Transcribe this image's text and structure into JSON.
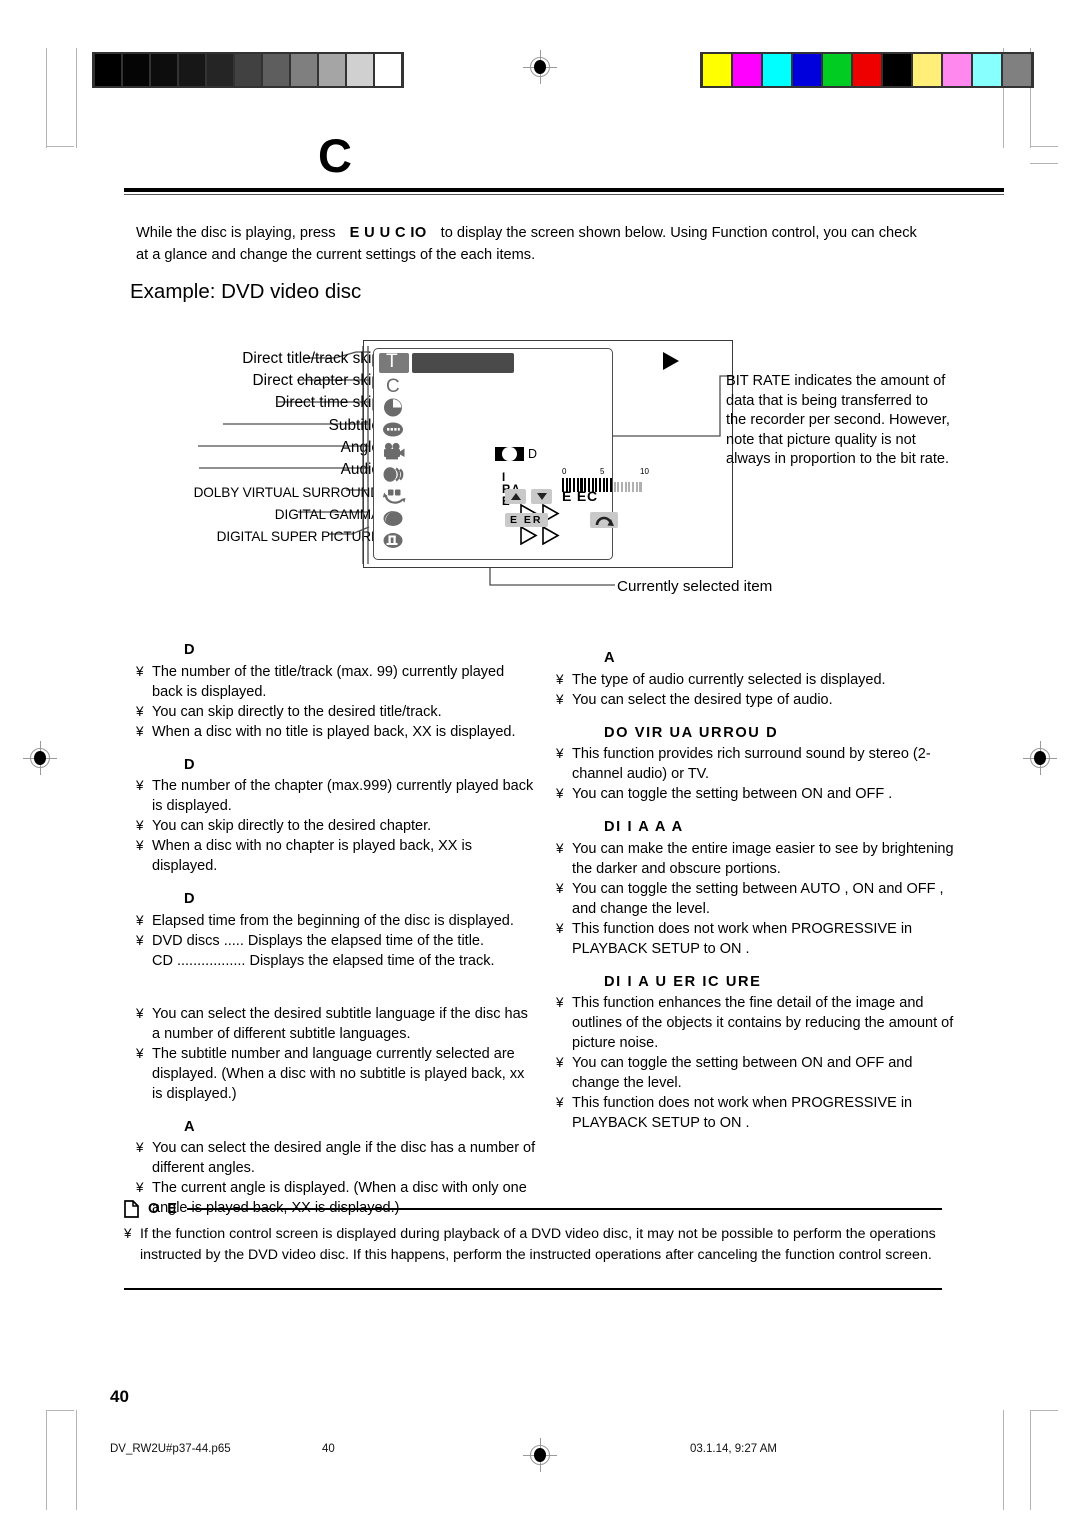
{
  "meta": {
    "page_number": "40",
    "footer_file": "DV_RW2U#p37-44.p65",
    "footer_page": "40",
    "footer_timestamp": "03.1.14, 9:27 AM"
  },
  "calibration": {
    "grayscale": [
      "#000000",
      "#050505",
      "#0d0d0d",
      "#171717",
      "#252525",
      "#414141",
      "#5e5e5e",
      "#7f7f7f",
      "#a5a5a5",
      "#d0d0d0",
      "#ffffff"
    ],
    "colors": [
      "#ffff00",
      "#ff00ff",
      "#00ffff",
      "#0000dd",
      "#00cc22",
      "#ee0000",
      "#000000",
      "#ffee77",
      "#ff88ee",
      "#88ffff",
      "#808080"
    ]
  },
  "header": {
    "title": "C",
    "intro_before": "While the disc is playing, press",
    "intro_key": "E U    U C IO",
    "intro_after": "to display the screen shown below. Using Function control, you can check at a glance and change the current settings of the each items.",
    "example_title": "Example: DVD video disc"
  },
  "diagram": {
    "callouts": [
      {
        "label": "Direct title/track skip",
        "icon": "title-icon"
      },
      {
        "label": "Direct chapter skip",
        "icon": "chapter-icon"
      },
      {
        "label": "Direct time skip",
        "icon": "clock-icon"
      },
      {
        "label": "Subtitle",
        "icon": "subtitle-icon"
      },
      {
        "label": "Angle",
        "icon": "camera-icon"
      },
      {
        "label": "Audio",
        "icon": "speaker-icon"
      },
      {
        "label": "DOLBY VIRTUAL SURROUND",
        "icon": "surround-icon"
      },
      {
        "label": "DIGITAL GAMMA",
        "icon": "gamma-icon"
      },
      {
        "label": "DIGITAL SUPER PICTURE",
        "icon": "super-picture-icon"
      }
    ],
    "osd": {
      "title_letter": "T",
      "chapter_letter": "C",
      "dolby_label": "D",
      "bitrate_label": "I  RA E",
      "bitrate_scale": [
        "0",
        "5",
        "10"
      ],
      "bitrate_value_pct": 62,
      "select_label": "E EC",
      "enter_label": "E  ER"
    },
    "selected_note": "Currently selected item",
    "bitrate_note": "BIT RATE indicates the amount of data that is being transferred to the recorder per second. However, note that picture quality is not always in proportion to the bit rate."
  },
  "left_column": [
    {
      "heading": "D",
      "bullets": [
        "The number of the title/track (max. 99) currently played back is displayed.",
        "You can skip directly to the desired title/track.",
        "When a disc with no title is played back, XX is displayed."
      ]
    },
    {
      "heading": "D",
      "bullets": [
        "The number of the chapter (max.999) currently played back is displayed.",
        "You can skip directly to the desired chapter.",
        "When a disc with no chapter is played back, XX is displayed."
      ]
    },
    {
      "heading": "D",
      "bullets": [
        "Elapsed time from the beginning of the disc is displayed.",
        "DVD discs ..... Displays the elapsed time of the title.\nCD ................. Displays the elapsed time of the track."
      ]
    },
    {
      "heading": "",
      "bullets": [
        "You can select the desired subtitle language if the disc has a number of different subtitle languages.",
        "The subtitle number and language currently selected are displayed. (When a disc with no subtitle is played back, xx is displayed.)"
      ]
    },
    {
      "heading": "A",
      "bullets": [
        "You can select the desired angle if the disc has a number of different angles.",
        "The current angle is displayed. (When a disc with only one angle is played back, XX is displayed.)"
      ]
    }
  ],
  "right_column": [
    {
      "heading": "A",
      "bullets": [
        "The type of audio currently selected is displayed.",
        "You can select the desired type of audio."
      ]
    },
    {
      "heading": "DO     VIR UA    URROU D",
      "bullets": [
        "This function provides rich surround sound by stereo (2-channel audio) or TV.",
        "You can toggle the setting between  ON  and  OFF ."
      ]
    },
    {
      "heading": "DI  I A    A    A",
      "bullets": [
        "You can make the entire image easier to see by brightening the darker and obscure portions.",
        "You can toggle the setting between  AUTO ,  ON  and  OFF , and change the level.",
        "This function does not work when  PROGRESSIVE  in  PLAYBACK SETUP  to  ON ."
      ]
    },
    {
      "heading": "DI  I A    U ER  IC URE",
      "bullets": [
        "This function enhances the fine detail of the image and outlines of the objects it contains by reducing the amount of picture noise.",
        "You can toggle the setting between  ON  and  OFF  and change the level.",
        "This function does not work when  PROGRESSIVE  in  PLAYBACK SETUP  to  ON ."
      ]
    }
  ],
  "note": {
    "title": "O E",
    "bullets": [
      "If the function control screen is displayed during playback of a DVD video disc, it may not be possible to perform the operations instructed by the DVD video disc.  If this happens, perform the instructed operations after canceling the function control screen."
    ]
  },
  "bullet_char": "¥"
}
